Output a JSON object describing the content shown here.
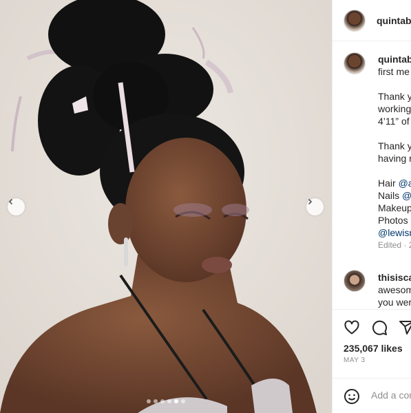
{
  "post": {
    "username": "quintab",
    "caption_lines": [
      {
        "type": "text",
        "text": "first me"
      },
      {
        "type": "gap"
      },
      {
        "type": "text",
        "text": "Thank y"
      },
      {
        "type": "text",
        "text": "working"
      },
      {
        "type": "text",
        "text": "4’11” of"
      },
      {
        "type": "gap"
      },
      {
        "type": "text",
        "text": "Thank y"
      },
      {
        "type": "text",
        "text": "having r"
      },
      {
        "type": "gap"
      }
    ],
    "credits": {
      "hair_label": "Hair ",
      "hair_mention": "@a",
      "nails_label": "Nails ",
      "nails_mention": "@",
      "makeup_label": "Makeup",
      "photos_label": "Photos",
      "photos_mention": "@lewisr"
    },
    "edited": "Edited · 2"
  },
  "comment": {
    "username": "thisisca",
    "line1": "awesom",
    "line2": "you wer"
  },
  "stats": {
    "likes": "235,067 likes",
    "date": "MAY 3"
  },
  "add_comment": {
    "placeholder": "Add a comment…"
  },
  "carousel": {
    "slide_count": 6,
    "active_index": 4
  },
  "icons": {
    "prev": "chevron-left-icon",
    "next": "chevron-right-icon",
    "like": "heart-icon",
    "comment": "comment-icon",
    "share": "share-icon",
    "emoji": "emoji-icon"
  }
}
